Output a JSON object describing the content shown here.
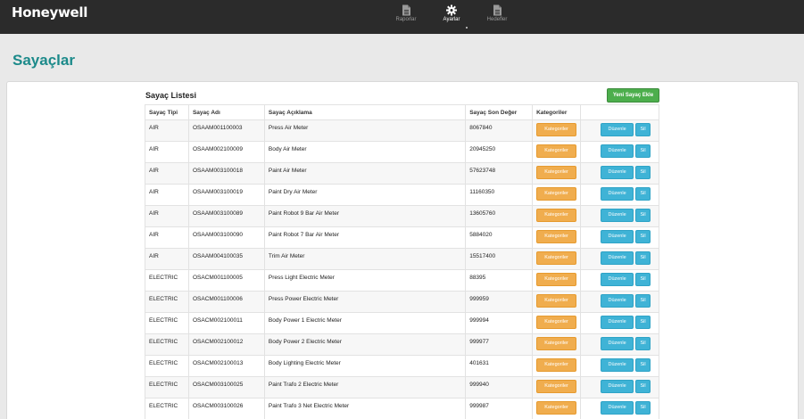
{
  "brand": {
    "name": "Honeywell"
  },
  "nav": [
    {
      "label": "Raporlar",
      "icon": "document-icon"
    },
    {
      "label": "Ayarlar",
      "icon": "gear-icon"
    },
    {
      "label": "Hedefler",
      "icon": "document-icon"
    }
  ],
  "page": {
    "title": "Sayaçlar"
  },
  "list": {
    "title": "Sayaç Listesi",
    "new_button": "Yeni Sayaç Ekle",
    "columns": [
      "Sayaç Tipi",
      "Sayaç Adı",
      "Sayaç Açıklama",
      "Sayaç Son Değer",
      "Kategoriler",
      ""
    ],
    "category_button": "Kategoriler",
    "edit_button": "Düzenle",
    "delete_button": "Sil",
    "rows": [
      {
        "type": "AIR",
        "name": "OSAAM001100003",
        "description": "Press Air Meter",
        "value": "8067840"
      },
      {
        "type": "AIR",
        "name": "OSAAM002100009",
        "description": "Body Air Meter",
        "value": "20945250"
      },
      {
        "type": "AIR",
        "name": "OSAAM003100018",
        "description": "Paint Air Meter",
        "value": "57623748"
      },
      {
        "type": "AIR",
        "name": "OSAAM003100019",
        "description": "Paint Dry Air Meter",
        "value": "11160350"
      },
      {
        "type": "AIR",
        "name": "OSAAM003100089",
        "description": "Paint Robot 9 Bar Air Meter",
        "value": "13605760"
      },
      {
        "type": "AIR",
        "name": "OSAAM003100090",
        "description": "Paint Robot 7 Bar Air Meter",
        "value": "5884020"
      },
      {
        "type": "AIR",
        "name": "OSAAM004100035",
        "description": "Trim Air Meter",
        "value": "15517400"
      },
      {
        "type": "ELECTRIC",
        "name": "OSACM001100005",
        "description": "Press Light Electric Meter",
        "value": "88395"
      },
      {
        "type": "ELECTRIC",
        "name": "OSACM001100006",
        "description": "Press Power Electric Meter",
        "value": "999959"
      },
      {
        "type": "ELECTRIC",
        "name": "OSACM002100011",
        "description": "Body Power 1 Electric Meter",
        "value": "999994"
      },
      {
        "type": "ELECTRIC",
        "name": "OSACM002100012",
        "description": "Body Power 2 Electric Meter",
        "value": "999977"
      },
      {
        "type": "ELECTRIC",
        "name": "OSACM002100013",
        "description": "Body Lighting Electric Meter",
        "value": "401631"
      },
      {
        "type": "ELECTRIC",
        "name": "OSACM003100025",
        "description": "Paint Trafo 2 Electric Meter",
        "value": "999940"
      },
      {
        "type": "ELECTRIC",
        "name": "OSACM003100026",
        "description": "Paint Trafo 3 Net Electric Meter",
        "value": "999987"
      }
    ]
  },
  "colors": {
    "topbar": "#2b2b2b",
    "title": "#1c8a8a",
    "success": "#4cae4c",
    "warning": "#f0ad4e",
    "info": "#3fb3d6"
  }
}
